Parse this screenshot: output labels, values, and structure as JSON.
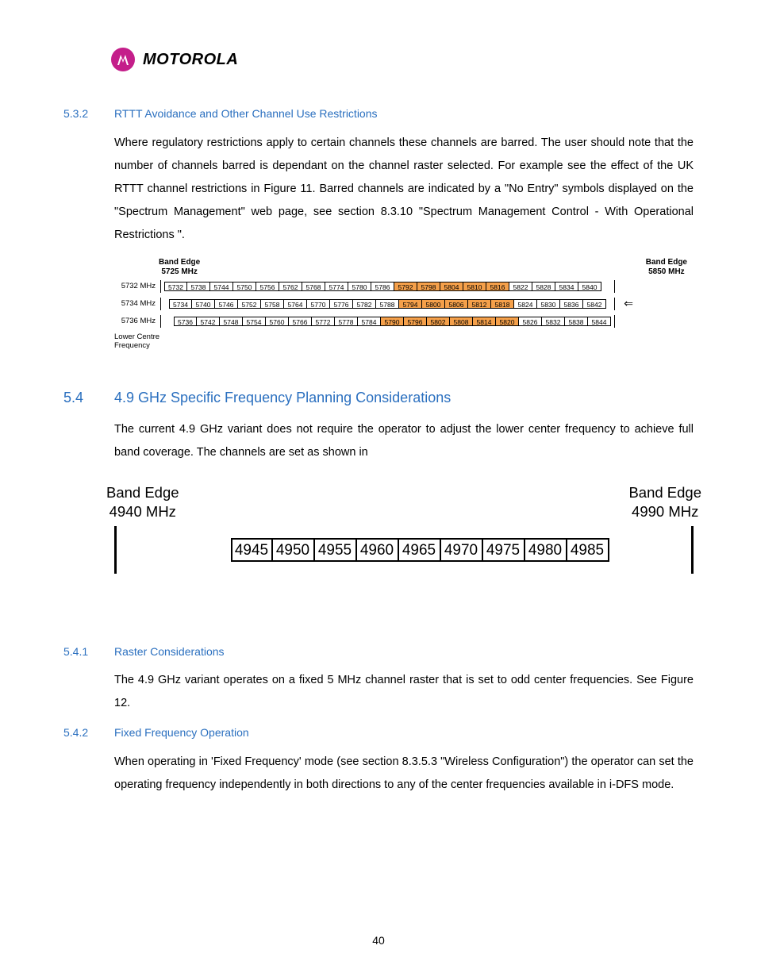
{
  "brand": "MOTOROLA",
  "sec_532": {
    "num": "5.3.2",
    "title": "RTTT Avoidance and Other Channel Use Restrictions"
  },
  "p1": "Where regulatory restrictions apply to certain channels these channels are barred. The user should note that the number of channels barred is dependant on the channel raster selected. For example see the effect of the UK RTTT channel restrictions in Figure 11. Barred channels are indicated by a \"No Entry\" symbols displayed on the \"Spectrum Management\" web page, see section 8.3.10 \"Spectrum Management Control - With Operational Restrictions \".",
  "fig1": {
    "edge_left_a": "Band Edge",
    "edge_left_b": "5725 MHz",
    "edge_right_a": "Band Edge",
    "edge_right_b": "5850 MHz",
    "bottom_a": "Lower Centre",
    "bottom_b": "Frequency",
    "rows": [
      {
        "label": "5732 MHz",
        "cells": [
          5732,
          5738,
          5744,
          5750,
          5756,
          5762,
          5768,
          5774,
          5780,
          5786,
          5792,
          5798,
          5804,
          5810,
          5816,
          5822,
          5828,
          5834,
          5840
        ],
        "barred": [
          10,
          11,
          12,
          13,
          14
        ]
      },
      {
        "label": "5734 MHz",
        "cells": [
          5734,
          5740,
          5746,
          5752,
          5758,
          5764,
          5770,
          5776,
          5782,
          5788,
          5794,
          5800,
          5806,
          5812,
          5818,
          5824,
          5830,
          5836,
          5842
        ],
        "barred": [
          10,
          11,
          12,
          13,
          14
        ],
        "arrow": true
      },
      {
        "label": "5736 MHz",
        "cells": [
          5736,
          5742,
          5748,
          5754,
          5760,
          5766,
          5772,
          5778,
          5784,
          5790,
          5796,
          5802,
          5808,
          5814,
          5820,
          5826,
          5832,
          5838,
          5844
        ],
        "barred": [
          9,
          10,
          11,
          12,
          13,
          14
        ]
      }
    ]
  },
  "sec_54": {
    "num": "5.4",
    "title": "4.9 GHz Specific Frequency Planning Considerations"
  },
  "p2": "The current 4.9 GHz variant does not require the operator to adjust the lower center frequency to achieve full band coverage. The channels are set as shown in",
  "fig2": {
    "edge_left_a": "Band Edge",
    "edge_left_b": "4940 MHz",
    "edge_right_a": "Band Edge",
    "edge_right_b": "4990 MHz",
    "cells": [
      4945,
      4950,
      4955,
      4960,
      4965,
      4970,
      4975,
      4980,
      4985
    ]
  },
  "sec_541": {
    "num": "5.4.1",
    "title": "Raster Considerations"
  },
  "p3": "The 4.9 GHz variant operates on a fixed 5 MHz channel raster that is set to odd center frequencies. See Figure 12.",
  "sec_542": {
    "num": "5.4.2",
    "title": "Fixed Frequency Operation"
  },
  "p4": "When operating in 'Fixed Frequency' mode (see section 8.3.5.3 \"Wireless Configuration\") the operator can set the operating frequency independently in both directions to any of the center frequencies available in i-DFS mode.",
  "page_number": "40"
}
